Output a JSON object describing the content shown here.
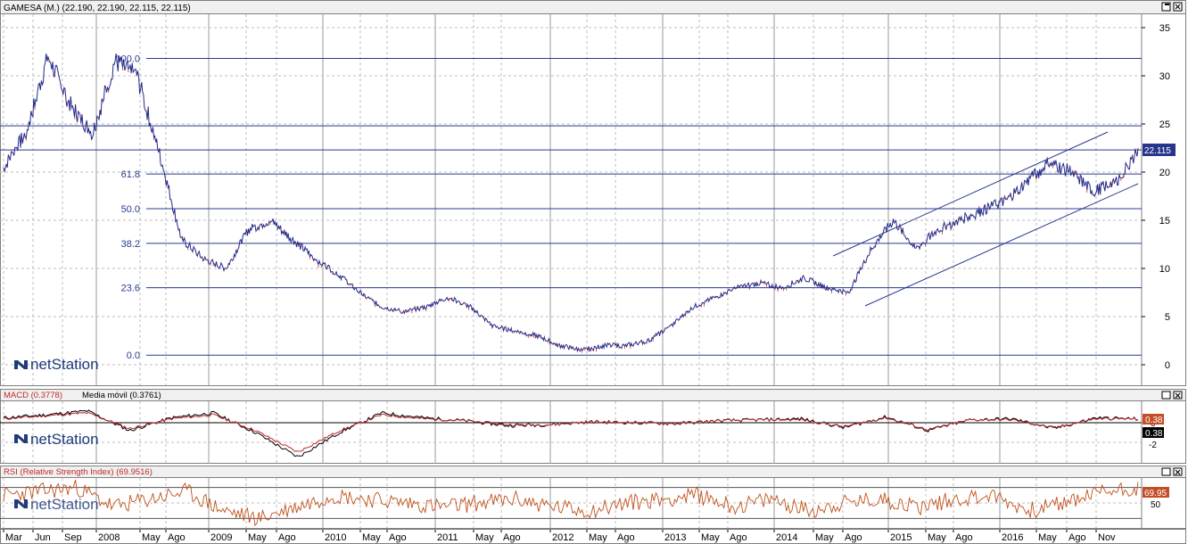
{
  "main": {
    "title": "GAMESA (M.) (22.190, 22.190, 22.115, 22.115)",
    "last_price_badge": "22.115",
    "watermark": "netStation",
    "y_ticks": [
      "35",
      "30",
      "25",
      "20",
      "15",
      "10",
      "5",
      "0"
    ],
    "fib_labels": [
      "100.0",
      "61.8",
      "50.0",
      "38.2",
      "23.6",
      "0.0"
    ]
  },
  "macd": {
    "title": "MACD (0.3778)",
    "ma_label": "Media móvil (0.3761)",
    "badge_macd": "0.38",
    "badge_ma": "0.38",
    "y_ticks": [
      "0",
      "-2"
    ],
    "watermark": "netStation"
  },
  "rsi": {
    "title": "RSI (Relative Strength Index) (69.9516)",
    "badge": "69.95",
    "y_ticks": [
      "50"
    ],
    "watermark": "netStation"
  },
  "x_axis": {
    "labels": [
      "Mar",
      "Jun",
      "Sep",
      "2008",
      "May",
      "Ago",
      "2009",
      "May",
      "Ago",
      "2010",
      "May",
      "Ago",
      "2011",
      "May",
      "Ago",
      "2012",
      "May",
      "Ago",
      "2013",
      "May",
      "Ago",
      "2014",
      "May",
      "Ago",
      "2015",
      "May",
      "Ago",
      "2016",
      "May",
      "Ago",
      "Nov"
    ]
  },
  "colors": {
    "up": "#1f2a8a",
    "down": "#c0282a",
    "accent": "#2a3a8f",
    "rsi": "#c0501a"
  },
  "chart_data": [
    {
      "type": "line",
      "title": "GAMESA (M.) (22.190, 22.190, 22.115, 22.115)",
      "ylim": [
        0,
        35
      ],
      "x": [
        "2007-03",
        "2007-06",
        "2007-09",
        "2007-10",
        "2008-01",
        "2008-05",
        "2008-07",
        "2008-09",
        "2008-10",
        "2008-11",
        "2009-03",
        "2009-05",
        "2009-09",
        "2009-11",
        "2010-01",
        "2010-03",
        "2010-05",
        "2010-07",
        "2010-10",
        "2011-01",
        "2011-03",
        "2011-06",
        "2011-09",
        "2012-01",
        "2012-03",
        "2012-06",
        "2012-08",
        "2012-10",
        "2013-01",
        "2013-03",
        "2013-06",
        "2013-09",
        "2013-11",
        "2014-01",
        "2014-04",
        "2014-06",
        "2014-08",
        "2014-10",
        "2014-12",
        "2015-03",
        "2015-05",
        "2015-08",
        "2015-10",
        "2015-12",
        "2016-02",
        "2016-04",
        "2016-06",
        "2016-08",
        "2016-09",
        "2016-10",
        "2016-11",
        "2016-12"
      ],
      "series": [
        {
          "values": [
            20.5,
            24,
            32,
            27,
            24,
            31.5,
            30,
            22,
            13,
            11,
            10,
            14,
            15,
            13,
            11,
            9.5,
            7.5,
            6,
            5.5,
            6,
            7,
            6,
            4,
            3.5,
            3,
            2,
            1.5,
            2,
            2,
            2.5,
            4,
            6,
            7,
            8,
            8.5,
            8,
            9,
            8,
            7.5,
            12,
            15,
            12,
            14,
            15,
            16,
            17,
            19,
            21,
            20,
            18,
            19,
            22.1
          ]
        }
      ],
      "fib_levels": [
        {
          "label": "100.0",
          "value": 31.8
        },
        {
          "label": "61.8",
          "value": 19.8
        },
        {
          "label": "50.0",
          "value": 16.2
        },
        {
          "label": "38.2",
          "value": 12.6
        },
        {
          "label": "23.6",
          "value": 8
        },
        {
          "label": "0.0",
          "value": 1
        }
      ],
      "extra_hlines": [
        24.8,
        22.3
      ]
    },
    {
      "type": "line",
      "title": "MACD (0.3778)",
      "ylim": [
        -4,
        2
      ],
      "series": [
        {
          "name": "MACD (0.3778)",
          "values": [
            0.5,
            0.8,
            1.2,
            -0.8,
            0.5,
            1,
            -1,
            -3.5,
            -1,
            1,
            0.5,
            0.2,
            -0.3,
            -0.2,
            0.1,
            0,
            -0.1,
            0.2,
            0.3,
            0.4,
            -0.5,
            0.6,
            -0.8,
            0.3,
            0.4,
            -0.6,
            0.5,
            0.38
          ]
        },
        {
          "name": "Media móvil (0.3761)",
          "values": [
            0.4,
            0.7,
            1,
            -0.6,
            0.4,
            0.8,
            -0.8,
            -3,
            -0.8,
            0.8,
            0.4,
            0.2,
            -0.2,
            -0.2,
            0.1,
            0,
            -0.1,
            0.2,
            0.3,
            0.3,
            -0.4,
            0.5,
            -0.7,
            0.3,
            0.3,
            -0.5,
            0.4,
            0.38
          ]
        }
      ]
    },
    {
      "type": "line",
      "title": "RSI (Relative Strength Index) (69.9516)",
      "ylim": [
        20,
        80
      ],
      "series": [
        {
          "name": "RSI (Relative Strength Index) (69.9516)",
          "values": [
            60,
            65,
            70,
            45,
            55,
            65,
            40,
            30,
            45,
            60,
            55,
            50,
            45,
            50,
            55,
            45,
            40,
            50,
            55,
            60,
            45,
            55,
            40,
            50,
            55,
            45,
            55,
            60,
            40,
            50,
            65,
            69.95
          ]
        }
      ]
    }
  ]
}
